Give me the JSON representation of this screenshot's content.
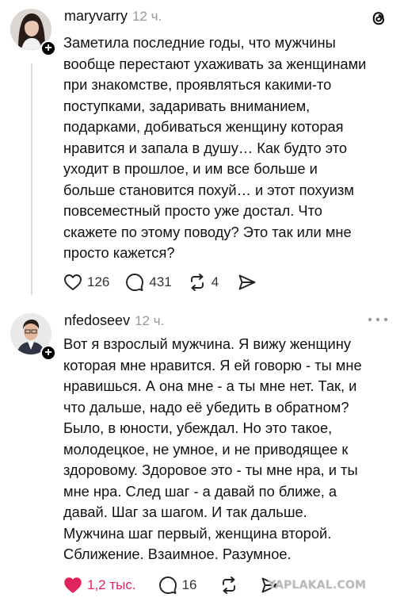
{
  "post1": {
    "username": "maryvarry",
    "time": "12 ч.",
    "text": "Заметила последние годы, что мужчины\nвообще перестают ухаживать за женщинами\nпри знакомстве, проявляться какими-то\nпоступками, задаривать вниманием,\nподарками, добиваться женщину которая\nнравится и запала в душу… Как будто это\nуходит в прошлое, и им все больше и\nбольше становится похуй… и этот похуизм\nповсеместный просто уже достал. Что\nскажете по этому поводу? Это так или мне\nпросто кажется?",
    "likes": "126",
    "comments": "431",
    "reposts": "4",
    "liked": false,
    "logo_icon": "threads-logo-icon"
  },
  "post2": {
    "username": "nfedoseev",
    "time": "12 ч.",
    "text": "Вот я взрослый мужчина. Я вижу женщину\nкоторая мне нравится. Я ей говорю - ты мне\nнравишься. А она мне - а ты мне нет. Так, и\nчто дальше, надо её убедить в обратном?\nБыло, в юности, убеждал. Но это такое,\nмолодецкое, не умное, и не приводящее к\nздоровому. Здоровое это - ты мне нра, и ты\nмне нра. След шаг - а давай по ближе, а\nдавай. Шаг за шагом. И так дальше.\nМужчина шаг первый, женщина второй.\nСближение. Взаимное. Разумное.",
    "likes": "1,2 тыс.",
    "comments": "16",
    "liked": true,
    "like_color": "#e0245e"
  },
  "watermark": "YAPLAKAL.COM"
}
